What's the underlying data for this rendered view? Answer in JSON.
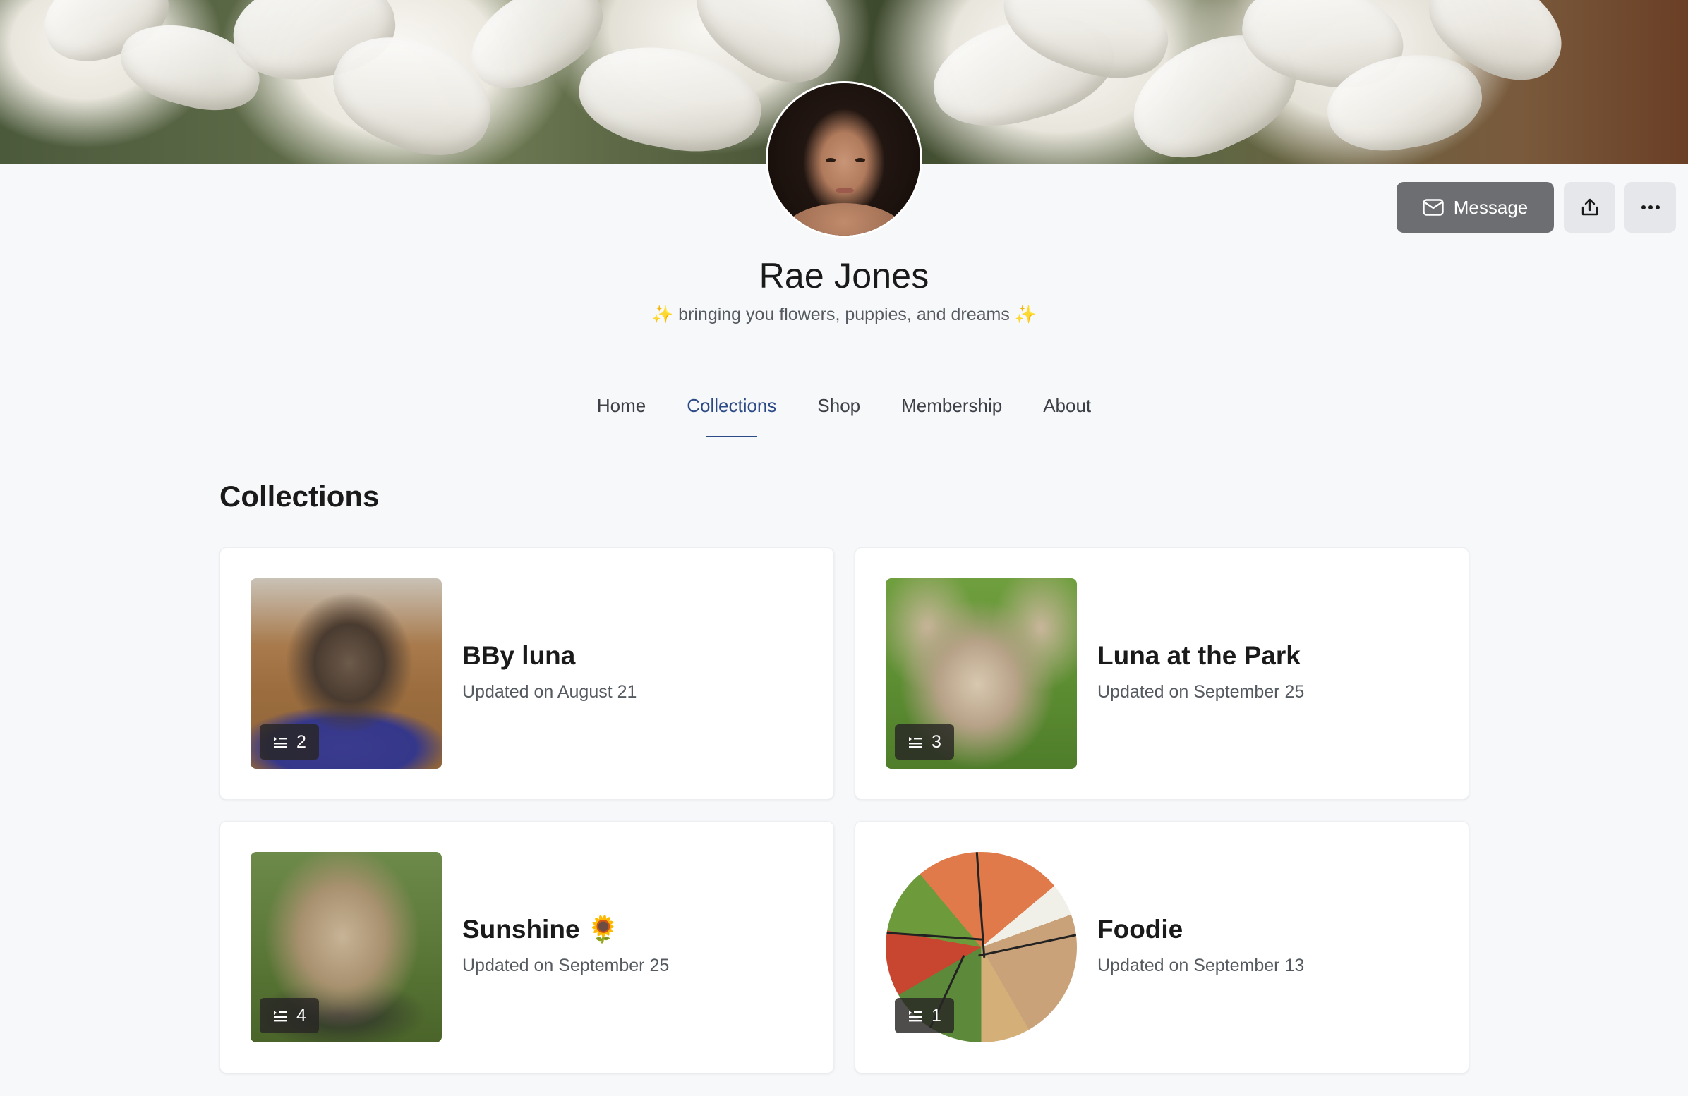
{
  "profile": {
    "name": "Rae Jones",
    "bio_spark": "✨",
    "bio": " bringing you flowers, puppies, and dreams "
  },
  "actions": {
    "message_label": "Message",
    "share_icon": "share-icon",
    "more_icon": "ellipsis-icon"
  },
  "tabs": [
    {
      "label": "Home",
      "active": false
    },
    {
      "label": "Collections",
      "active": true
    },
    {
      "label": "Shop",
      "active": false
    },
    {
      "label": "Membership",
      "active": false
    },
    {
      "label": "About",
      "active": false
    }
  ],
  "section": {
    "title": "Collections"
  },
  "collections": [
    {
      "title": "BBy luna",
      "updated": "Updated on August 21",
      "count": "2"
    },
    {
      "title": "Luna at the Park",
      "updated": "Updated on September 25",
      "count": "3"
    },
    {
      "title": "Sunshine 🌻",
      "updated": "Updated on September 25",
      "count": "4"
    },
    {
      "title": "Foodie",
      "updated": "Updated on September 13",
      "count": "1"
    }
  ],
  "colors": {
    "accent": "#2c4a86",
    "message_button": "#6c6e72",
    "background": "#f7f8fa"
  }
}
